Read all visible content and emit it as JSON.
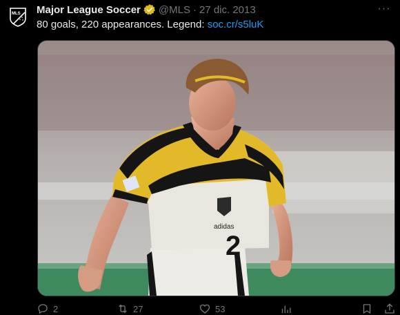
{
  "tweet": {
    "author_name": "Major League Soccer",
    "handle": "@MLS",
    "separator": "·",
    "date": "27 dic. 2013",
    "text_prefix": "80 goals, 220 appearances. Legend: ",
    "link_text": "soc.cr/s5luK",
    "more_label": "···"
  },
  "avatar": {
    "logo_text": "MLS"
  },
  "media": {
    "jersey_badge": "adidas",
    "jersey_number": "2",
    "colors": {
      "stripe_yellow": "#e2b928",
      "stripe_black": "#151515",
      "kit_white": "#e8e6de"
    }
  },
  "actions": {
    "reply_count": "2",
    "retweet_count": "27",
    "like_count": "53"
  },
  "colors": {
    "accent": "#1d9bf0",
    "muted": "#71767b",
    "text": "#e7e9ea",
    "verified_gold": "#e2b719"
  }
}
